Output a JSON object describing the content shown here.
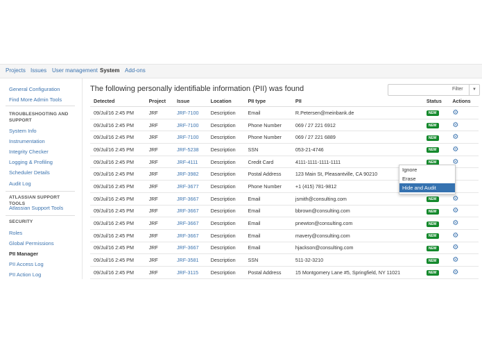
{
  "nav": {
    "items": [
      "Projects",
      "Issues",
      "User management",
      "System",
      "Add-ons"
    ],
    "active": "System"
  },
  "sidebar": {
    "links1": [
      "General Configuration",
      "Find More Admin Tools"
    ],
    "section1": "TROUBLESHOOTING AND SUPPORT",
    "links2": [
      "System Info",
      "Instrumentation",
      "Integrity Checker",
      "Logging & Profiling",
      "Scheduler Details",
      "Audit Log"
    ],
    "section2": "ATLASSIAN SUPPORT TOOLS",
    "links3": [
      "Atlassian Support Tools"
    ],
    "section3": "SECURITY",
    "links4": [
      "Roles",
      "Global Permissions",
      "PII Manager",
      "PII Access Log",
      "PII Action Log"
    ],
    "current": "PII Manager"
  },
  "main": {
    "title": "The following personally identifiable information (PII) was found",
    "filter": {
      "value": "",
      "button": "Filter",
      "dropdown_icon": "caret-down-icon"
    },
    "columns": [
      "Detected",
      "Project",
      "Issue",
      "Location",
      "PII type",
      "PII",
      "Status",
      "Actions"
    ],
    "rows": [
      [
        "09/Jul/16 2:45 PM",
        "JRF",
        "JRF-7100",
        "Description",
        "Email",
        "R.Petersen@meinbank.de",
        "NEW"
      ],
      [
        "09/Jul/16 2:45 PM",
        "JRF",
        "JRF-7100",
        "Description",
        "Phone Number",
        "069 / 27 221 6912",
        "NEW"
      ],
      [
        "09/Jul/16 2:45 PM",
        "JRF",
        "JRF-7100",
        "Description",
        "Phone Number",
        "069 / 27 221 6889",
        "NEW"
      ],
      [
        "09/Jul/16 2:45 PM",
        "JRF",
        "JRF-5238",
        "Description",
        "SSN",
        "053-21-4746",
        "NEW"
      ],
      [
        "09/Jul/16 2:45 PM",
        "JRF",
        "JRF-4111",
        "Description",
        "Credit Card",
        "4111-1111-1111-1111",
        "NEW"
      ],
      [
        "09/Jul/16 2:45 PM",
        "JRF",
        "JRF-3982",
        "Description",
        "Postal Address",
        "123 Main St, Pleasantville, CA 90210",
        ""
      ],
      [
        "09/Jul/16 2:45 PM",
        "JRF",
        "JRF-3677",
        "Description",
        "Phone Number",
        "+1 (415) 781-9812",
        ""
      ],
      [
        "09/Jul/16 2:45 PM",
        "JRF",
        "JRF-3667",
        "Description",
        "Email",
        "jsmith@consulting.com",
        "NEW"
      ],
      [
        "09/Jul/16 2:45 PM",
        "JRF",
        "JRF-3667",
        "Description",
        "Email",
        "bbrown@consulting.com",
        "NEW"
      ],
      [
        "09/Jul/16 2:45 PM",
        "JRF",
        "JRF-3667",
        "Description",
        "Email",
        "pnewton@consulting.com",
        "NEW"
      ],
      [
        "09/Jul/16 2:45 PM",
        "JRF",
        "JRF-3667",
        "Description",
        "Email",
        "mavery@consulting.com",
        "NEW"
      ],
      [
        "09/Jul/16 2:45 PM",
        "JRF",
        "JRF-3667",
        "Description",
        "Email",
        "hjackson@consulting.com",
        "NEW"
      ],
      [
        "09/Jul/16 2:45 PM",
        "JRF",
        "JRF-3581",
        "Description",
        "SSN",
        "511-32-3210",
        "NEW"
      ],
      [
        "09/Jul/16 2:45 PM",
        "JRF",
        "JRF-3115",
        "Description",
        "Postal Address",
        "15 Montgomery Lane #5, Springfield, NY 11021",
        "NEW"
      ]
    ],
    "action_icon": "gear-icon",
    "badge_color": "#14892c",
    "action_menu": {
      "items": [
        "Ignore",
        "Erase",
        "Hide and Audit"
      ],
      "highlighted": "Hide and Audit",
      "open_on_row": 5
    }
  }
}
